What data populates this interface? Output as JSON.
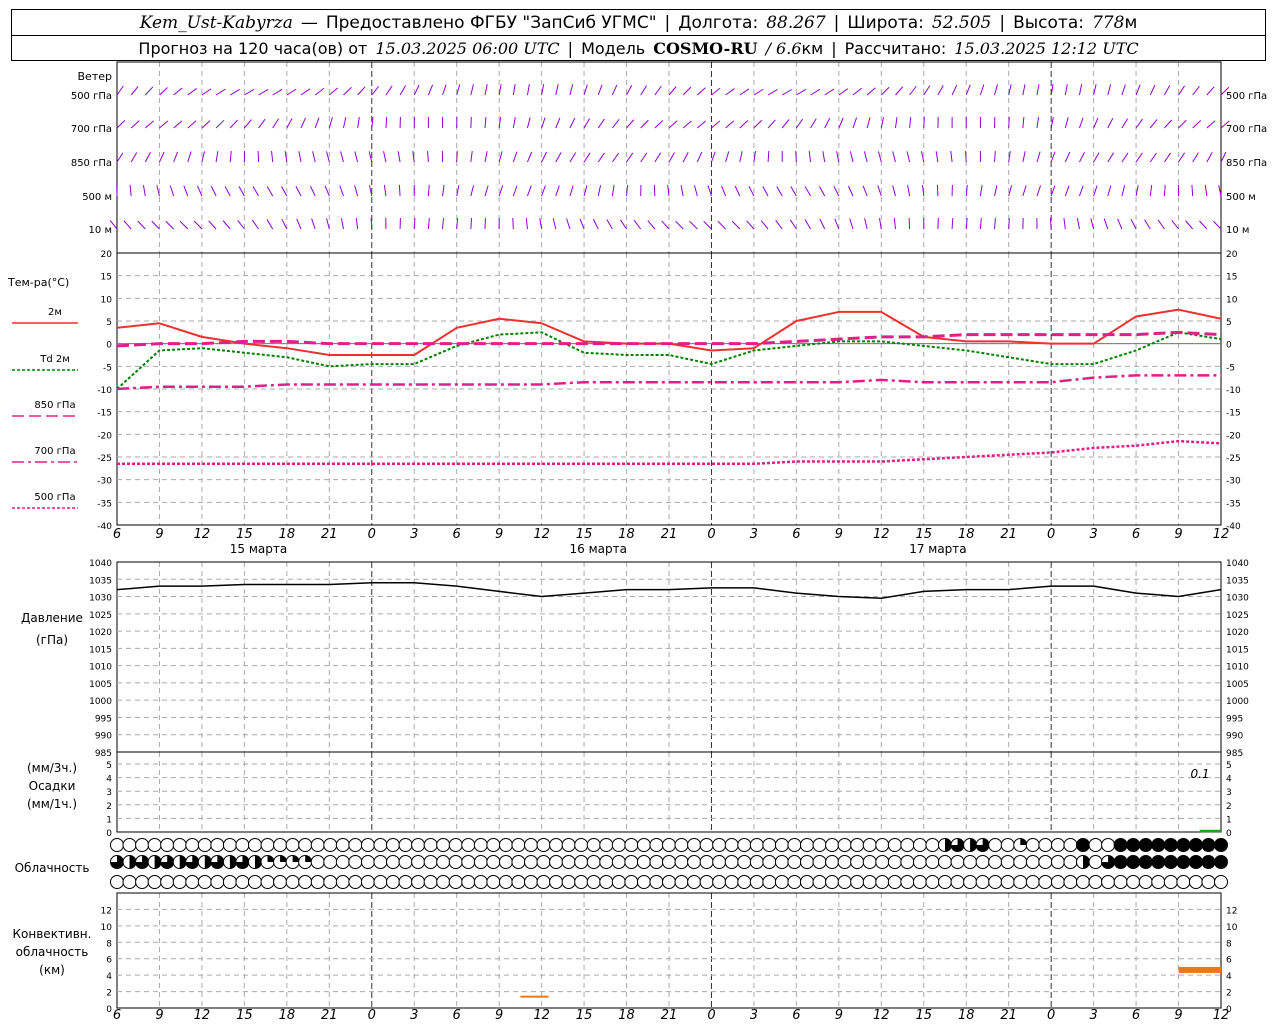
{
  "header": {
    "station": "Kem_Ust-Kabyrza",
    "provider": "Предоставлено ФГБУ \"ЗапСиб УГМС\"",
    "lon_label": "Долгота:",
    "lon_value": "88.267",
    "lat_label": "Широта:",
    "lat_value": "52.505",
    "alt_label": "Высота:",
    "alt_value": "778",
    "alt_unit": "м",
    "forecast_prefix": "Прогноз на 120 часа(ов) от",
    "forecast_start": "15.03.2025 06:00 UTC",
    "model_label": "Модель",
    "model_name": "COSMO-RU",
    "model_res": "/ 6.6",
    "model_unit": "км",
    "calc_label": "Рассчитано:",
    "calc_time": "15.03.2025 12:12 UTC"
  },
  "time_axis": {
    "hour_labels": [
      "6",
      "9",
      "12",
      "15",
      "18",
      "21",
      "0",
      "3",
      "6",
      "9",
      "12",
      "15",
      "18",
      "21",
      "0",
      "3",
      "6",
      "9",
      "12",
      "15",
      "18",
      "21",
      "0",
      "3",
      "6",
      "9",
      "12"
    ],
    "day_labels": [
      "15 марта",
      "16 марта",
      "17 марта"
    ]
  },
  "wind": {
    "title": "Ветер",
    "levels": [
      "500 гПа",
      "700 гПа",
      "850 гПа",
      "500 м",
      "10  м"
    ],
    "levels_right": [
      "500 гПа",
      "700 гПа",
      "850 гПа",
      "500 м",
      "10  м"
    ],
    "colors": {
      "barb": "#9000d0"
    }
  },
  "temperature": {
    "title": "Тем-ра(°С)",
    "legend": [
      "2м",
      "Td  2м",
      "850 гПа",
      "700 гПа",
      "500 гПа"
    ],
    "tick_labels": [
      "20",
      "15",
      "10",
      "5",
      "0",
      "-5",
      "-10",
      "-15",
      "-20",
      "-25",
      "-30",
      "-35",
      "-40"
    ],
    "colors": {
      "t2m": "#ee3030",
      "td2m": "#008000",
      "t850": "#e0208a",
      "t700": "#e0208a",
      "t500": "#e0208a"
    }
  },
  "pressure": {
    "title": "Давление",
    "unit": "(гПа)",
    "tick_labels": [
      "1040",
      "1035",
      "1030",
      "1025",
      "1020",
      "1015",
      "1010",
      "1005",
      "1000",
      "995",
      "990",
      "985"
    ]
  },
  "precip": {
    "unit_top": "(мм/3ч.)",
    "title": "Осадки",
    "unit_bottom": "(мм/1ч.)",
    "tick_labels": [
      "5",
      "4",
      "3",
      "2",
      "1",
      "0"
    ],
    "annotation": "0.1"
  },
  "cloud": {
    "title": "Облачность"
  },
  "convective": {
    "title_lines": [
      "Конвективн.",
      "облачность",
      "(км)"
    ],
    "tick_labels": [
      "12",
      "10",
      "8",
      "6",
      "4",
      "2",
      "0"
    ]
  },
  "chart_data": [
    {
      "type": "line",
      "title": "Тем-ра(°С)",
      "x_hours": [
        0,
        3,
        6,
        9,
        12,
        15,
        18,
        21,
        24,
        27,
        30,
        33,
        36,
        39,
        42,
        45,
        48,
        51,
        54,
        57,
        60,
        63,
        66,
        69,
        72,
        75,
        78
      ],
      "ylim": [
        -40,
        20
      ],
      "series": [
        {
          "name": "2м",
          "values": [
            3.5,
            4.5,
            1.5,
            0,
            -1,
            -2.5,
            -2.5,
            -2.5,
            3.5,
            5.5,
            4.5,
            0.5,
            0,
            0,
            -1.5,
            -1,
            5,
            7,
            7,
            1.5,
            0.5,
            0.5,
            0,
            0,
            6,
            7.5,
            5.5
          ]
        },
        {
          "name": "Td  2м",
          "values": [
            -10,
            -1.5,
            -1,
            -2,
            -3,
            -5,
            -4.5,
            -4.5,
            -0.5,
            2,
            2.5,
            -2,
            -2.5,
            -2.5,
            -4.5,
            -1.5,
            -0.5,
            0.5,
            0.5,
            -0.5,
            -1.5,
            -3,
            -4.5,
            -4.5,
            -1.5,
            2.5,
            1
          ]
        },
        {
          "name": "850 гПа",
          "values": [
            -0.5,
            0,
            0,
            0.5,
            0.5,
            0,
            0,
            0,
            0,
            0,
            0,
            0,
            0,
            0,
            0,
            0,
            0.5,
            1,
            1.5,
            1.5,
            2,
            2,
            2,
            2,
            2,
            2.5,
            2
          ]
        },
        {
          "name": "700 гПа",
          "values": [
            -10,
            -9.5,
            -9.5,
            -9.5,
            -9,
            -9,
            -9,
            -9,
            -9,
            -9,
            -9,
            -8.5,
            -8.5,
            -8.5,
            -8.5,
            -8.5,
            -8.5,
            -8.5,
            -8,
            -8.5,
            -8.5,
            -8.5,
            -8.5,
            -7.5,
            -7,
            -7,
            -7
          ]
        },
        {
          "name": "500 гПа",
          "values": [
            -26.5,
            -26.5,
            -26.5,
            -26.5,
            -26.5,
            -26.5,
            -26.5,
            -26.5,
            -26.5,
            -26.5,
            -26.5,
            -26.5,
            -26.5,
            -26.5,
            -26.5,
            -26.5,
            -26,
            -26,
            -26,
            -25.5,
            -25,
            -24.5,
            -24,
            -23,
            -22.5,
            -21.5,
            -22
          ]
        }
      ]
    },
    {
      "type": "line",
      "title": "Давление",
      "x_hours": [
        0,
        3,
        6,
        9,
        12,
        15,
        18,
        21,
        24,
        27,
        30,
        33,
        36,
        39,
        42,
        45,
        48,
        51,
        54,
        57,
        60,
        63,
        66,
        69,
        72,
        75,
        78
      ],
      "ylim": [
        985,
        1040
      ],
      "series": [
        {
          "name": "Давление",
          "values": [
            1032,
            1033,
            1033,
            1033.5,
            1033.5,
            1033.5,
            1034,
            1034,
            1033,
            1031.5,
            1030,
            1031,
            1032,
            1032,
            1032.5,
            1032.5,
            1031,
            1030,
            1029.5,
            1031.5,
            1032,
            1032,
            1033,
            1033,
            1031,
            1030,
            1032
          ]
        }
      ]
    },
    {
      "type": "bar",
      "title": "Осадки",
      "x_hours": [
        78
      ],
      "ylim": [
        0,
        5
      ],
      "values": [
        0.1
      ]
    },
    {
      "type": "table",
      "title": "Облачность",
      "x_hours": [
        0,
        1,
        2,
        3,
        4,
        5,
        6,
        7,
        8,
        9,
        10,
        11,
        12,
        13,
        14,
        15,
        16,
        17,
        18,
        19,
        20,
        21,
        22,
        23,
        24,
        25,
        26,
        27,
        28,
        29,
        30,
        31,
        32,
        33,
        34,
        35,
        36,
        37,
        38,
        39,
        40,
        41,
        42,
        43,
        44,
        45,
        46,
        47,
        48,
        49,
        50,
        51,
        52,
        53,
        54,
        55,
        56,
        57,
        58,
        59,
        60,
        61,
        62,
        63,
        64,
        65,
        66,
        67,
        68,
        69,
        70,
        71,
        72,
        73,
        74,
        75,
        76,
        77,
        78
      ],
      "rows": [
        {
          "level": "high",
          "values": [
            0,
            0,
            0,
            0,
            0,
            0,
            0,
            0,
            0,
            0,
            0,
            0,
            0,
            0,
            0,
            0,
            0,
            0,
            0,
            0,
            0,
            0,
            0,
            0,
            0,
            0,
            0,
            0,
            0,
            0,
            0,
            0,
            0,
            0,
            0,
            0,
            0,
            0,
            0,
            0,
            0,
            0,
            0,
            0,
            0,
            0,
            0,
            0,
            0,
            0,
            0,
            0,
            0,
            0,
            0,
            0,
            0,
            0,
            0,
            0,
            0,
            0,
            0,
            0,
            0,
            0,
            0.5,
            0.75,
            0.5,
            0.75,
            0,
            0,
            0.25,
            0,
            0,
            0,
            0,
            1,
            0,
            0,
            1,
            1,
            1,
            1,
            1,
            1,
            1,
            1,
            1
          ]
        },
        {
          "level": "middle",
          "values": [
            0.75,
            0.5,
            0.75,
            0.5,
            0.75,
            0.5,
            0.75,
            0.5,
            0.75,
            0.5,
            0.75,
            0.5,
            0.25,
            0.25,
            0.25,
            0.25,
            0,
            0,
            0,
            0,
            0,
            0,
            0,
            0,
            0,
            0,
            0,
            0,
            0,
            0,
            0,
            0,
            0,
            0,
            0,
            0,
            0,
            0,
            0,
            0,
            0,
            0,
            0,
            0,
            0,
            0,
            0,
            0,
            0,
            0,
            0,
            0,
            0,
            0,
            0,
            0,
            0,
            0,
            0,
            0,
            0,
            0,
            0,
            0,
            0,
            0,
            0,
            0,
            0,
            0,
            0,
            0,
            0,
            0,
            0,
            0,
            0,
            0.5,
            0,
            0.75,
            1,
            1,
            1,
            1,
            1,
            1,
            1,
            1,
            1
          ]
        },
        {
          "level": "low",
          "values": [
            0,
            0,
            0,
            0,
            0,
            0,
            0,
            0,
            0,
            0,
            0,
            0,
            0,
            0,
            0,
            0,
            0,
            0,
            0,
            0,
            0,
            0,
            0,
            0,
            0,
            0,
            0,
            0,
            0,
            0,
            0,
            0,
            0,
            0,
            0,
            0,
            0,
            0,
            0,
            0,
            0,
            0,
            0,
            0,
            0,
            0,
            0,
            0,
            0,
            0,
            0,
            0,
            0,
            0,
            0,
            0,
            0,
            0,
            0,
            0,
            0,
            0,
            0,
            0,
            0,
            0,
            0,
            0,
            0,
            0,
            0,
            0,
            0,
            0,
            0,
            0,
            0,
            0,
            0,
            0,
            0,
            0,
            0,
            0,
            0,
            0,
            0,
            0,
            0
          ]
        }
      ]
    },
    {
      "type": "bar",
      "title": "Конвективн. облачность (км)",
      "bars": [
        {
          "x_start": 28.5,
          "x_end": 30.5,
          "bottom_km": 0,
          "top_km": 1.5
        },
        {
          "x_start": 75,
          "x_end": 78,
          "bottom_km": 0,
          "top_km": 5
        }
      ],
      "ylim": [
        0,
        14
      ]
    }
  ]
}
